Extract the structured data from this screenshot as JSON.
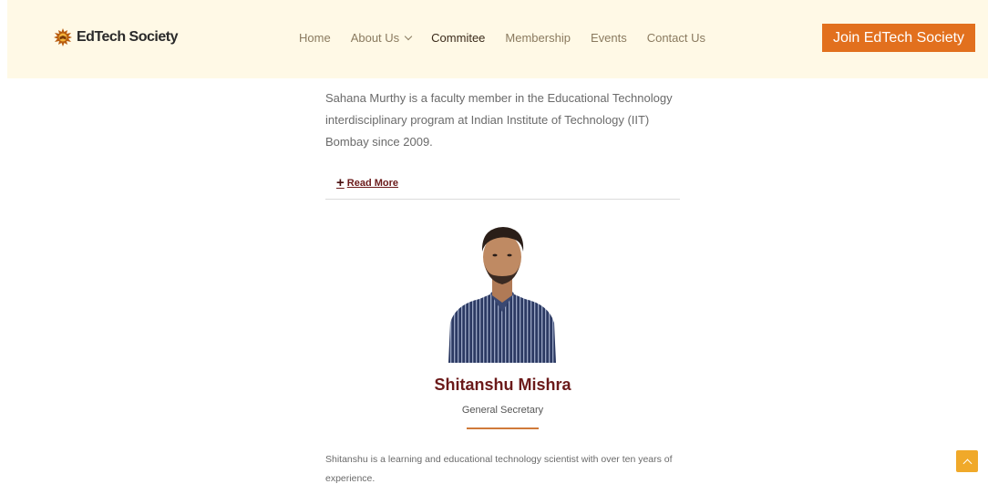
{
  "header": {
    "logo_text": "EdTech Society",
    "nav": [
      {
        "label": "Home"
      },
      {
        "label": "About Us"
      },
      {
        "label": "Commitee"
      },
      {
        "label": "Membership"
      },
      {
        "label": "Events"
      },
      {
        "label": "Contact Us"
      }
    ],
    "cta_label": "Join EdTech Society"
  },
  "previous_member": {
    "bio": "Sahana Murthy is a faculty member in the Educational Technology interdisciplinary program at Indian Institute of Technology (IIT) Bombay since 2009.",
    "read_more_label": "Read More"
  },
  "member": {
    "name": "Shitanshu Mishra",
    "role": "General Secretary",
    "bio": "Shitanshu is a learning and educational technology scientist with over ten years of experience."
  },
  "colors": {
    "header_bg": "#fff9e6",
    "accent": "#e2701e",
    "name_color": "#6b1a1a"
  },
  "icons": {
    "logo": "gear-book-icon",
    "scroll_top": "chevron-up-icon"
  }
}
